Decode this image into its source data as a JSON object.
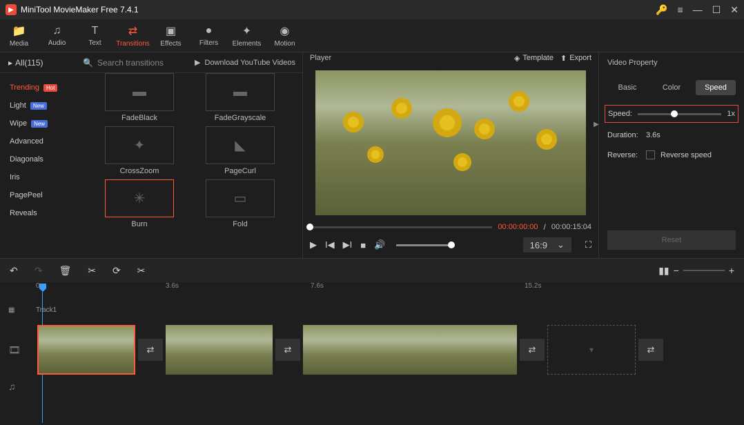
{
  "titlebar": {
    "title": "MiniTool MovieMaker Free 7.4.1"
  },
  "toolbar": {
    "items": [
      {
        "id": "media",
        "label": "Media",
        "icon": "folder"
      },
      {
        "id": "audio",
        "label": "Audio",
        "icon": "music"
      },
      {
        "id": "text",
        "label": "Text",
        "icon": "T"
      },
      {
        "id": "transitions",
        "label": "Transitions",
        "icon": "swap",
        "active": true
      },
      {
        "id": "effects",
        "label": "Effects",
        "icon": "sparkle"
      },
      {
        "id": "filters",
        "label": "Filters",
        "icon": "drop"
      },
      {
        "id": "elements",
        "label": "Elements",
        "icon": "star"
      },
      {
        "id": "motion",
        "label": "Motion",
        "icon": "circle"
      }
    ]
  },
  "transitions": {
    "all_label": "All(115)",
    "search_placeholder": "Search transitions",
    "yt_label": "Download YouTube Videos",
    "categories": [
      {
        "label": "Trending",
        "badge": "Hot",
        "active": true
      },
      {
        "label": "Light",
        "badge": "New"
      },
      {
        "label": "Wipe",
        "badge": "New"
      },
      {
        "label": "Advanced"
      },
      {
        "label": "Diagonals"
      },
      {
        "label": "Iris"
      },
      {
        "label": "PagePeel"
      },
      {
        "label": "Reveals"
      }
    ],
    "items": [
      {
        "label": "FadeBlack"
      },
      {
        "label": "FadeGrayscale"
      },
      {
        "label": "CrossZoom"
      },
      {
        "label": "PageCurl"
      },
      {
        "label": "Burn",
        "selected": true
      },
      {
        "label": "Fold"
      }
    ]
  },
  "player": {
    "label": "Player",
    "template": "Template",
    "export": "Export",
    "time_current": "00:00:00:00",
    "time_total": "00:00:15:04",
    "ratio": "16:9"
  },
  "props": {
    "title": "Video Property",
    "tabs": [
      "Basic",
      "Color",
      "Speed"
    ],
    "active_tab": 2,
    "speed_label": "Speed:",
    "speed_value": "1x",
    "duration_label": "Duration:",
    "duration_value": "3.6s",
    "reverse_label": "Reverse:",
    "reverse_check": "Reverse speed",
    "reset": "Reset"
  },
  "timeline": {
    "marks": [
      "0s",
      "3.6s",
      "7.6s",
      "15.2s"
    ],
    "track_label": "Track1"
  }
}
